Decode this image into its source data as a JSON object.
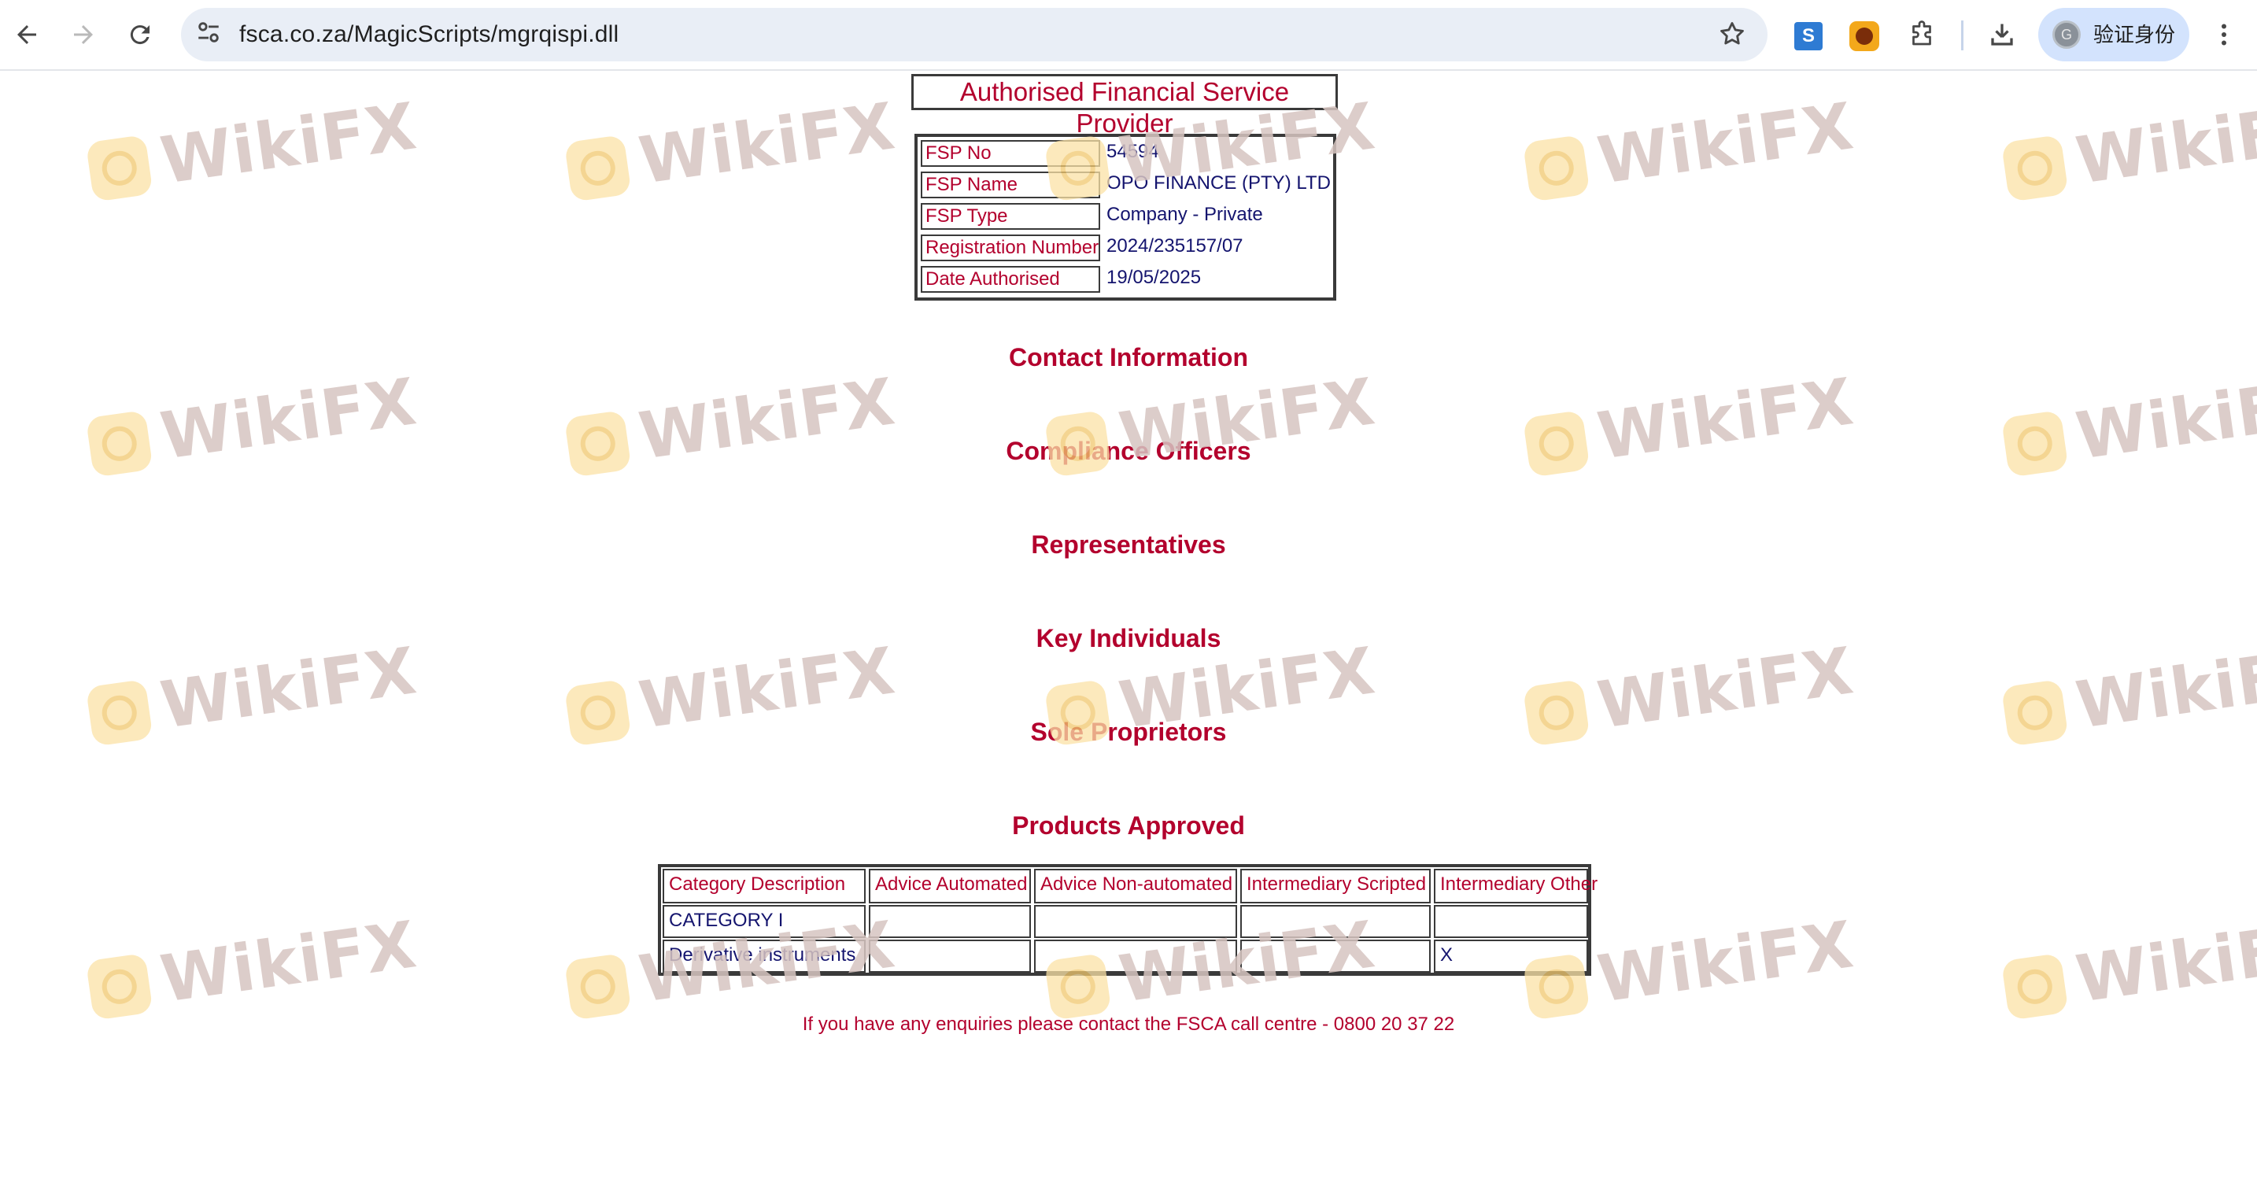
{
  "browser": {
    "url": "fsca.co.za/MagicScripts/mgrqispi.dll",
    "profile_label": "验证身份",
    "icons": [
      "back-icon",
      "forward-icon",
      "reload-icon",
      "site-info-icon",
      "bookmark-star-icon",
      "extension-s-icon",
      "extension-w-icon",
      "extensions-puzzle-icon",
      "download-icon",
      "menu-kebab-icon"
    ]
  },
  "watermark": {
    "text": "WikiFX"
  },
  "page": {
    "title": "Authorised Financial Service Provider",
    "fsp_details": [
      {
        "label": "FSP No",
        "value": "54594"
      },
      {
        "label": "FSP Name",
        "value": "OPO FINANCE (PTY) LTD"
      },
      {
        "label": "FSP Type",
        "value": "Company - Private"
      },
      {
        "label": "Registration Number",
        "value": "2024/235157/07"
      },
      {
        "label": "Date Authorised",
        "value": "19/05/2025"
      }
    ],
    "sections": {
      "contact": "Contact Information",
      "compliance": "Compliance Officers",
      "representatives": "Representatives",
      "key_individuals": "Key Individuals",
      "sole_proprietors": "Sole Proprietors",
      "products": "Products Approved"
    },
    "products_table": {
      "headers": [
        "Category Description",
        "Advice Automated",
        "Advice Non-automated",
        "Intermediary Scripted",
        "Intermediary Other"
      ],
      "rows": [
        [
          "CATEGORY I",
          "",
          "",
          "",
          ""
        ],
        [
          "Derivative instruments",
          "",
          "",
          "",
          "X"
        ]
      ]
    },
    "footer": "If you have any enquiries please contact the FSCA call centre - 0800 20 37 22"
  },
  "colors": {
    "heading_red": "#b3002d",
    "value_navy": "#14146e",
    "border": "#3a3a3a",
    "omnibox_bg": "#e9eef6",
    "profile_bg": "#d3e3fd"
  }
}
